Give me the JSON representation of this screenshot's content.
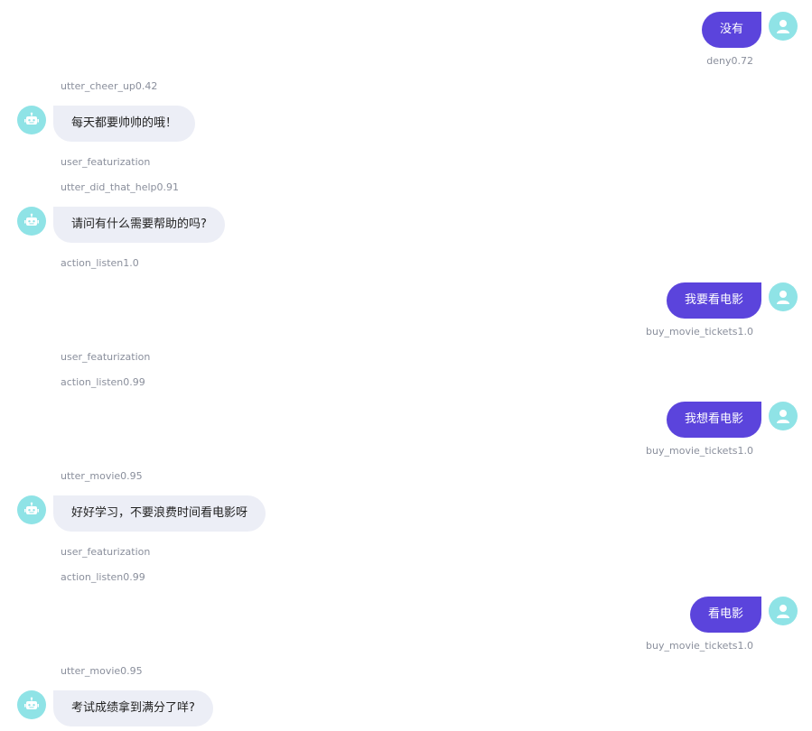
{
  "colors": {
    "user_bubble": "#5b44dc",
    "bot_bubble": "#eceef6",
    "avatar": "#8fe3e6",
    "label": "#8a8f9c"
  },
  "messages": [
    {
      "type": "user",
      "text": "没有",
      "intent": "deny0.72"
    },
    {
      "type": "action",
      "text": "utter_cheer_up0.42"
    },
    {
      "type": "bot",
      "text": "每天都要帅帅的哦！"
    },
    {
      "type": "action",
      "text": "user_featurization"
    },
    {
      "type": "action",
      "text": "utter_did_that_help0.91"
    },
    {
      "type": "bot",
      "text": "请问有什么需要帮助的吗?"
    },
    {
      "type": "action",
      "text": "action_listen1.0"
    },
    {
      "type": "user",
      "text": "我要看电影",
      "intent": "buy_movie_tickets1.0"
    },
    {
      "type": "action",
      "text": "user_featurization"
    },
    {
      "type": "action",
      "text": "action_listen0.99"
    },
    {
      "type": "user",
      "text": "我想看电影",
      "intent": "buy_movie_tickets1.0"
    },
    {
      "type": "action",
      "text": "utter_movie0.95"
    },
    {
      "type": "bot",
      "text": "好好学习，不要浪费时间看电影呀"
    },
    {
      "type": "action",
      "text": "user_featurization"
    },
    {
      "type": "action",
      "text": "action_listen0.99"
    },
    {
      "type": "user",
      "text": "看电影",
      "intent": "buy_movie_tickets1.0"
    },
    {
      "type": "action",
      "text": "utter_movie0.95"
    },
    {
      "type": "bot",
      "text": "考试成绩拿到满分了咩?"
    }
  ],
  "icons": {
    "user_avatar": "user-icon",
    "bot_avatar": "robot-icon"
  }
}
